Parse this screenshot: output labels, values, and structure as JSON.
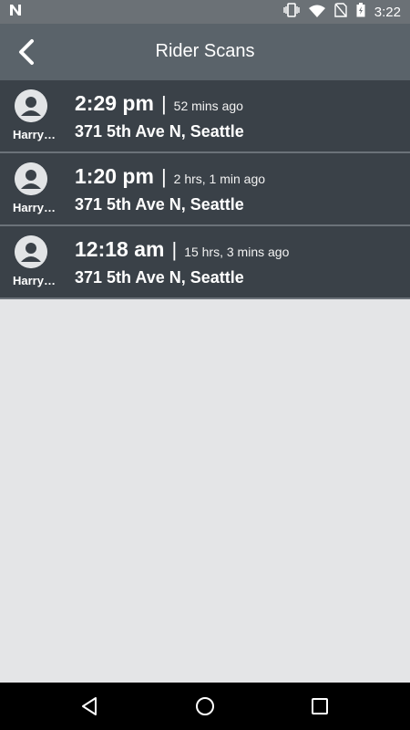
{
  "status_bar": {
    "time": "3:22",
    "left_icon": "n-notification-icon",
    "icons": [
      "vibrate-icon",
      "wifi-icon",
      "no-sim-icon",
      "battery-charging-icon"
    ]
  },
  "header": {
    "title": "Rider Scans",
    "back_icon": "chevron-left-icon"
  },
  "scans": [
    {
      "rider": "Harry…",
      "time": "2:29 pm",
      "separator": "|",
      "ago": "52 mins ago",
      "address": "371 5th Ave N, Seattle"
    },
    {
      "rider": "Harry…",
      "time": "1:20 pm",
      "separator": "|",
      "ago": "2 hrs, 1 min ago",
      "address": "371 5th Ave N, Seattle"
    },
    {
      "rider": "Harry…",
      "time": "12:18 am",
      "separator": "|",
      "ago": "15 hrs, 3 mins ago",
      "address": "371 5th Ave N, Seattle"
    }
  ],
  "nav": {
    "back": "back-triangle-icon",
    "home": "home-circle-icon",
    "recents": "recents-square-icon"
  },
  "colors": {
    "status_bar": "#6b7176",
    "app_bar": "#5a636a",
    "row_bg": "#3a4148",
    "page_bg": "#e4e5e7"
  }
}
